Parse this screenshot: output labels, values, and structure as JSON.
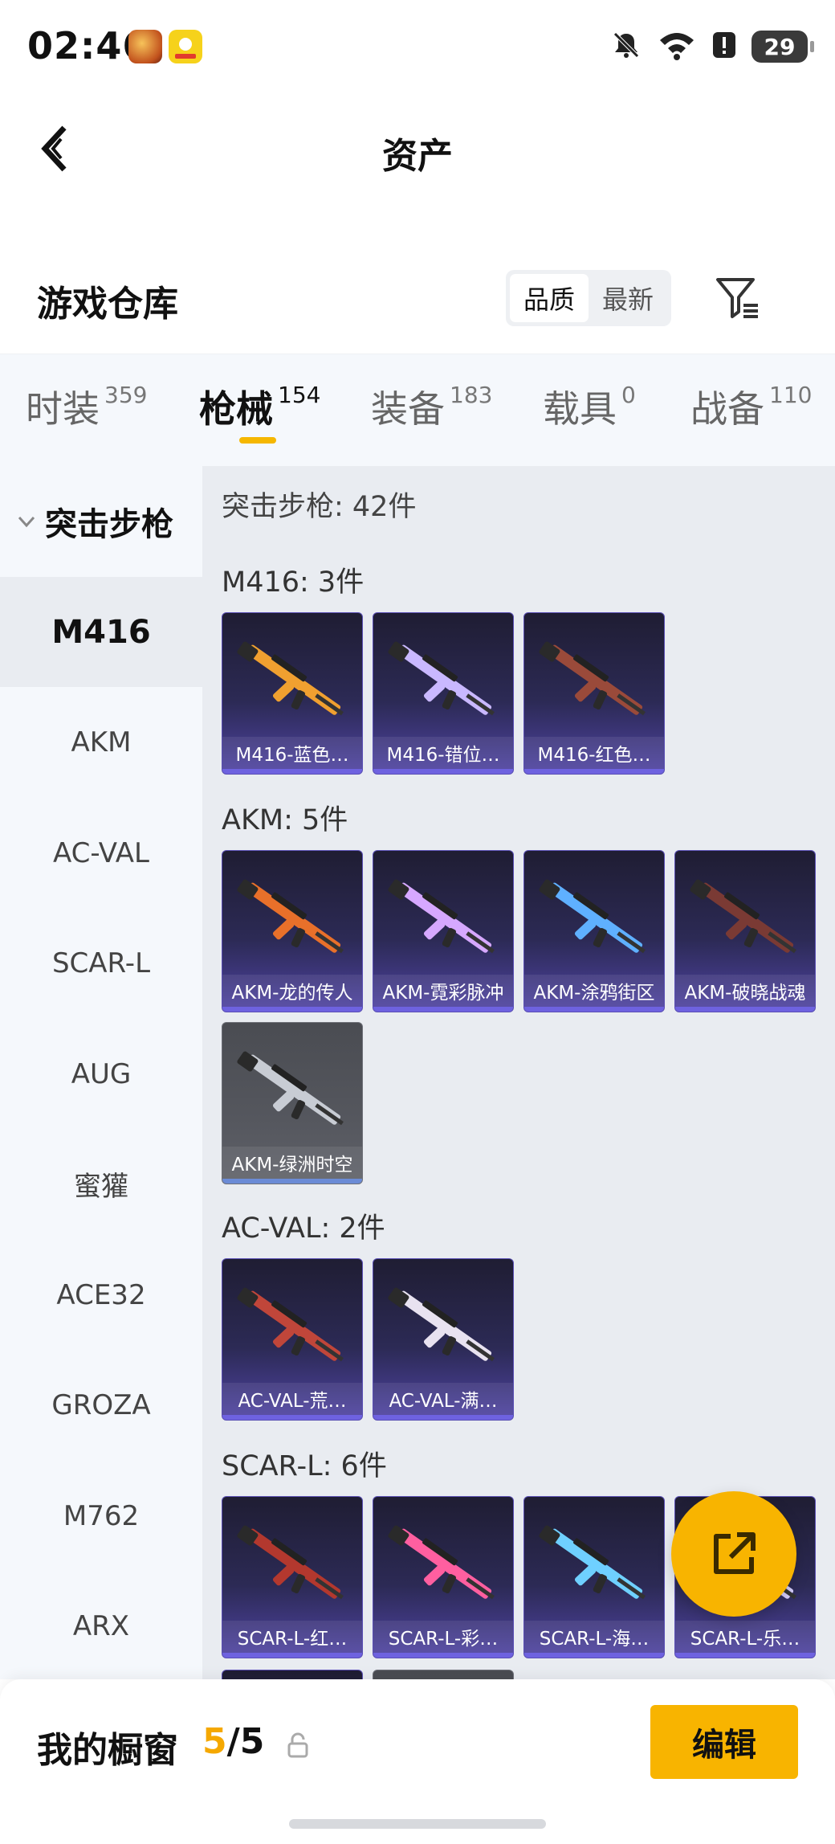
{
  "status_bar": {
    "time": "02:46",
    "battery_level": "29",
    "icons": [
      "app-icon-hero",
      "app-icon-yellow",
      "mute-bell-icon",
      "wifi-icon",
      "alert-icon",
      "battery-icon"
    ]
  },
  "nav": {
    "title": "资产",
    "back_icon": "chevron-left-icon"
  },
  "warehouse": {
    "title": "游戏仓库",
    "sort_options": [
      "品质",
      "最新"
    ],
    "sort_selected": "品质",
    "filter_icon": "filter-icon"
  },
  "categories": [
    {
      "label": "时装",
      "count": "359",
      "active": false
    },
    {
      "label": "枪械",
      "count": "154",
      "active": true
    },
    {
      "label": "装备",
      "count": "183",
      "active": false
    },
    {
      "label": "载具",
      "count": "0",
      "active": false
    },
    {
      "label": "战备",
      "count": "110",
      "active": false
    }
  ],
  "sidebar": {
    "group_label": "突击步枪",
    "group_icon": "chevron-down-icon",
    "items": [
      "M416",
      "AKM",
      "AC-VAL",
      "SCAR-L",
      "AUG",
      "蜜獾",
      "ACE32",
      "GROZA",
      "M762",
      "ARX"
    ],
    "active_item": "M416"
  },
  "content": {
    "summary": "突击步枪: 42件",
    "sections": [
      {
        "title": "M416: 3件",
        "items": [
          {
            "label": "M416-蓝色…",
            "tint": "#f0a030"
          },
          {
            "label": "M416-错位…",
            "tint": "#c9b8ff"
          },
          {
            "label": "M416-红色…",
            "tint": "#9a4a3a"
          }
        ]
      },
      {
        "title": "AKM: 5件",
        "items": [
          {
            "label": "AKM-龙的传人",
            "tint": "#e8702a"
          },
          {
            "label": "AKM-霓彩脉冲",
            "tint": "#d6a8ff"
          },
          {
            "label": "AKM-涂鸦街区",
            "tint": "#5fb0ff"
          },
          {
            "label": "AKM-破晓战魂",
            "tint": "#7a3a34"
          },
          {
            "label": "AKM-绿洲时空",
            "tint": "#c8ccd4",
            "gray": true
          }
        ]
      },
      {
        "title": "AC-VAL: 2件",
        "items": [
          {
            "label": "AC-VAL-荒…",
            "tint": "#c0463a"
          },
          {
            "label": "AC-VAL-满…",
            "tint": "#e8e2f0"
          }
        ]
      },
      {
        "title": "SCAR-L: 6件",
        "items": [
          {
            "label": "SCAR-L-红…",
            "tint": "#b3382e"
          },
          {
            "label": "SCAR-L-彩…",
            "tint": "#ff5fa0"
          },
          {
            "label": "SCAR-L-海…",
            "tint": "#6fd0ff"
          },
          {
            "label": "SCAR-L-乐…",
            "tint": "#d8d0ff"
          }
        ]
      }
    ]
  },
  "fab": {
    "icon": "share-export-icon"
  },
  "bottom_bar": {
    "title": "我的橱窗",
    "current": "5",
    "separator": "/",
    "total": "5",
    "lock_icon": "lock-icon",
    "edit_label": "编辑"
  },
  "colors": {
    "accent": "#f8b400",
    "active_tab_indicator": "#f5b700",
    "card_gradient_bottom": "#4f43a3"
  }
}
